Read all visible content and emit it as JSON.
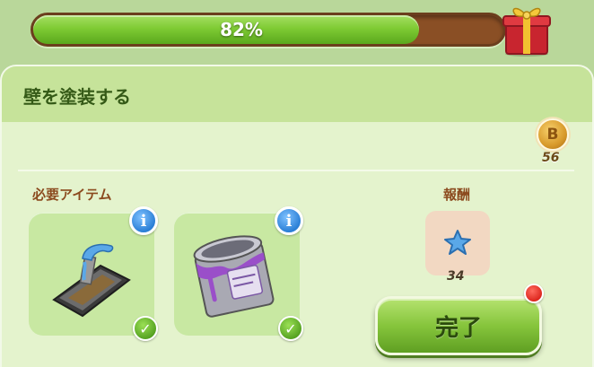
{
  "progress": {
    "percent_text": "82%",
    "fraction": 0.82,
    "fill_color": "#7fcb34",
    "track_color": "#8a4f25"
  },
  "panel": {
    "title": "壁を塗装する"
  },
  "currency": {
    "coin_symbol": "B",
    "coin_value": "56",
    "icon": "coin-icon"
  },
  "required_items": {
    "label": "必要アイテム",
    "items": [
      {
        "icon": "trowel-icon",
        "info_symbol": "i",
        "check_symbol": "✓"
      },
      {
        "icon": "paint-can-icon",
        "info_symbol": "i",
        "check_symbol": "✓"
      }
    ]
  },
  "reward": {
    "label": "報酬",
    "icon": "star-icon",
    "value": "34"
  },
  "complete_button": {
    "label": "完了"
  },
  "colors": {
    "accent_green": "#86c53c",
    "info_blue": "#2b7fd6",
    "notification_red": "#d81e16"
  }
}
